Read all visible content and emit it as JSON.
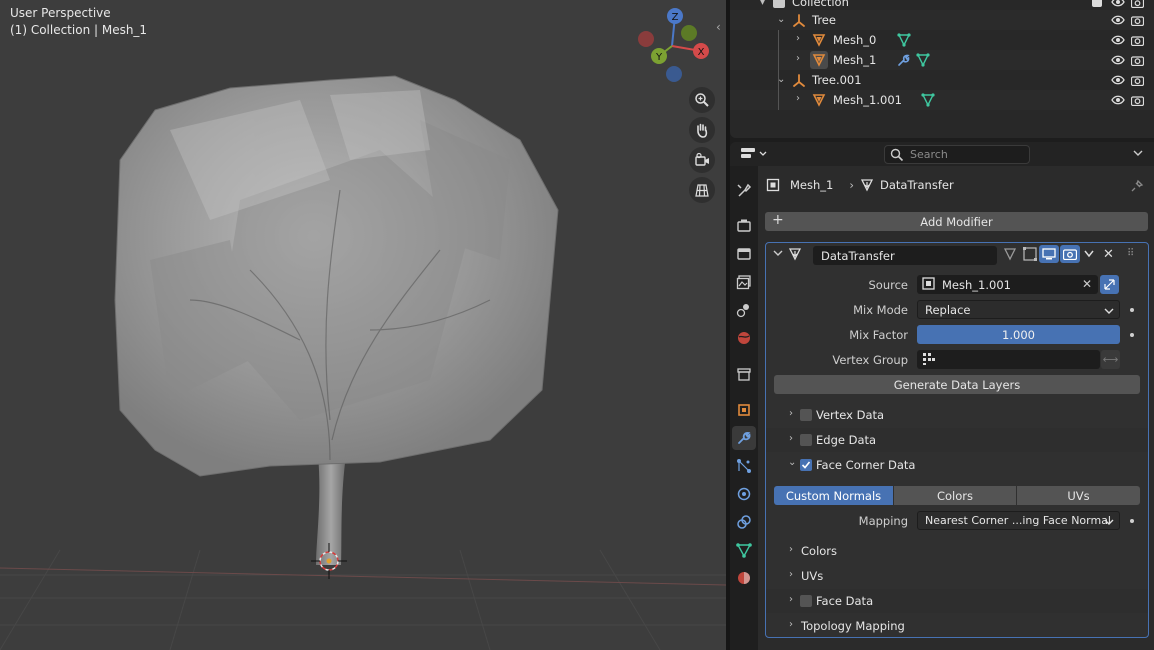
{
  "viewport": {
    "title": "User Perspective",
    "subtitle": "(1) Collection | Mesh_1",
    "gizmo": {
      "z": "Z",
      "x": "X",
      "y": "Y"
    }
  },
  "outliner": {
    "rows": [
      {
        "label": "Collection"
      },
      {
        "label": "Tree"
      },
      {
        "label": "Mesh_0"
      },
      {
        "label": "Mesh_1"
      },
      {
        "label": "Tree.001"
      },
      {
        "label": "Mesh_1.001"
      }
    ]
  },
  "properties": {
    "search_placeholder": "Search",
    "breadcrumb": {
      "object": "Mesh_1",
      "modifier": "DataTransfer"
    },
    "add_modifier_label": "Add Modifier",
    "modifier": {
      "name": "DataTransfer",
      "source_label": "Source",
      "source_value": "Mesh_1.001",
      "mix_mode_label": "Mix Mode",
      "mix_mode_value": "Replace",
      "mix_factor_label": "Mix Factor",
      "mix_factor_value": "1.000",
      "vertex_group_label": "Vertex Group",
      "generate_label": "Generate Data Layers",
      "vertex_data_label": "Vertex Data",
      "edge_data_label": "Edge Data",
      "face_corner_label": "Face Corner Data",
      "face_corner_checked": true,
      "tabs": [
        "Custom Normals",
        "Colors",
        "UVs"
      ],
      "active_tab": "Custom Normals",
      "mapping_label": "Mapping",
      "mapping_value": "Nearest Corner ...ing Face Normal",
      "colors_label": "Colors",
      "uvs_label": "UVs",
      "face_data_label": "Face Data",
      "topology_label": "Topology Mapping"
    }
  },
  "colors": {
    "accent": "#4772b3",
    "viewport_bg": "#3d3d3d",
    "panel_bg": "#2b2b2b"
  }
}
